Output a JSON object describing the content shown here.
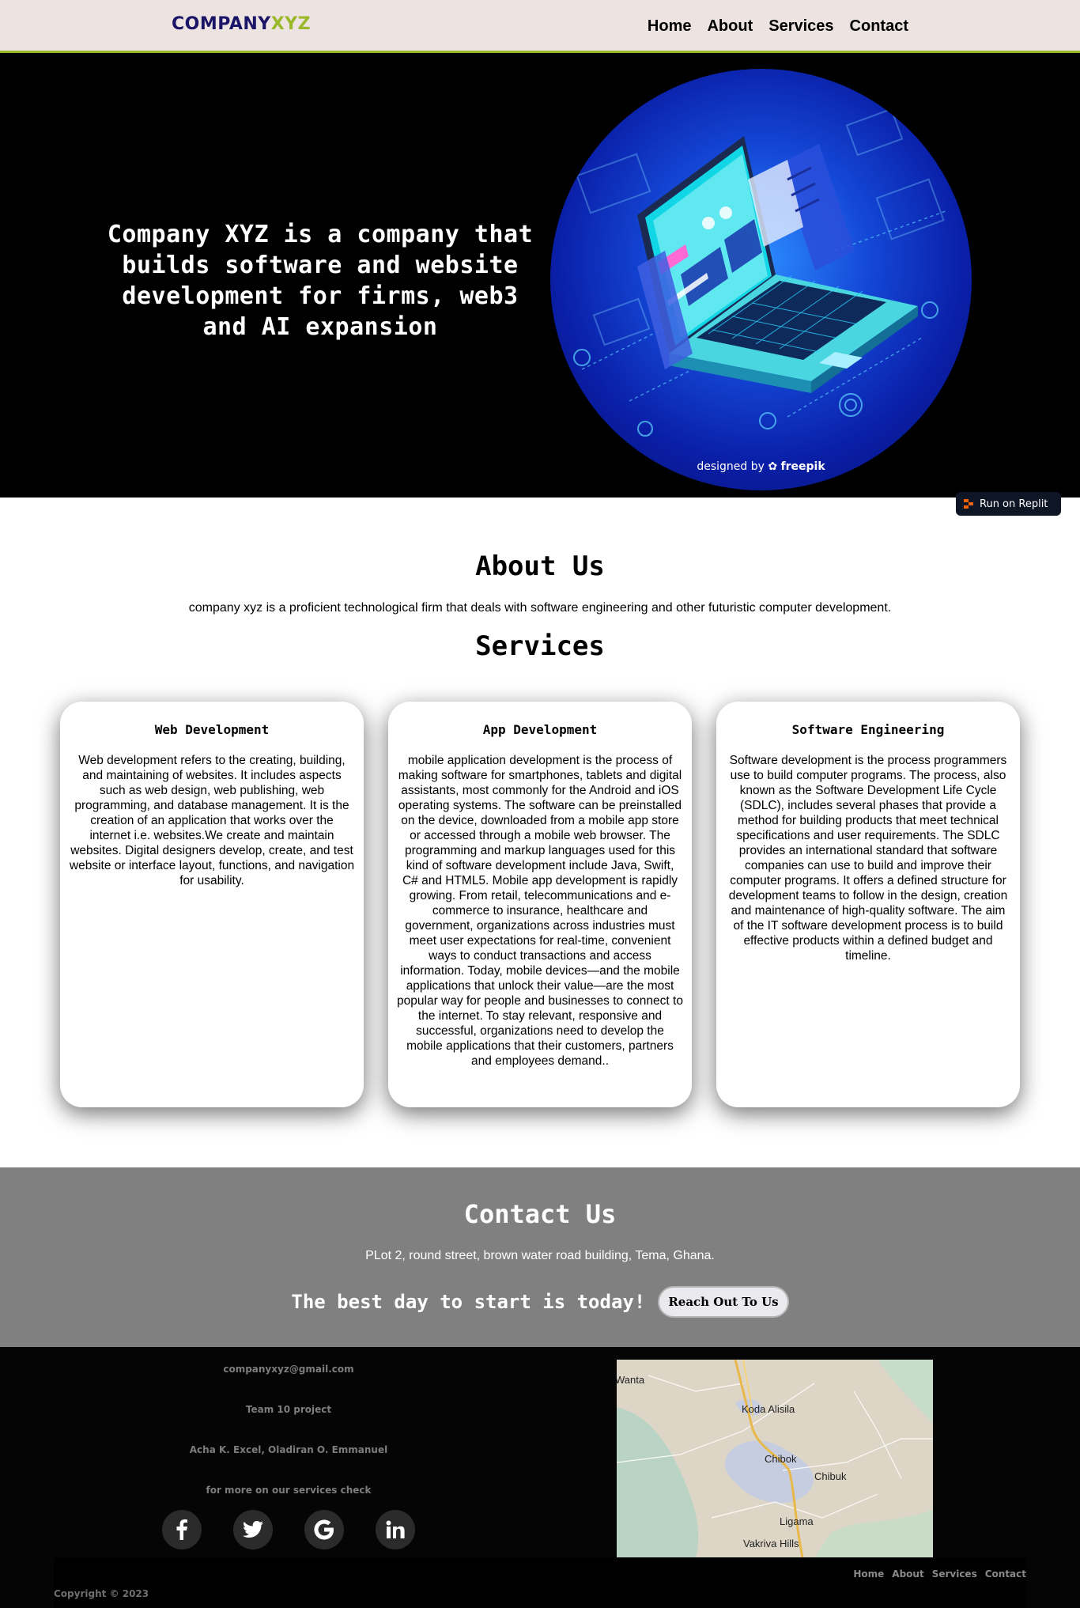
{
  "header": {
    "logo_part1": "COMPANY",
    "logo_part2": "XYZ",
    "nav": [
      "Home",
      "About",
      "Services",
      "Contact"
    ]
  },
  "hero": {
    "headline": "Company XYZ is a company that builds software and website development for firms, web3 and AI expansion",
    "image_credit_prefix": "designed by",
    "image_credit_brand": "freepik",
    "image_icon": "laptop-illustration"
  },
  "replit_badge": "Run on Replit",
  "about": {
    "title": "About Us",
    "text": "company xyz is a proficient technological firm that deals with software engineering and other futuristic computer development."
  },
  "services": {
    "title": "Services",
    "cards": [
      {
        "title": "Web Development",
        "text": "Web development refers to the creating, building, and maintaining of websites. It includes aspects such as web design, web publishing, web programming, and database management. It is the creation of an application that works over the internet i.e. websites.We create and maintain websites. Digital designers develop, create, and test website or interface layout, functions, and navigation for usability."
      },
      {
        "title": "App Development",
        "text": "mobile application development is the process of making software for smartphones, tablets and digital assistants, most commonly for the Android and iOS operating systems. The software can be preinstalled on the device, downloaded from a mobile app store or accessed through a mobile web browser. The programming and markup languages used for this kind of software development include Java, Swift, C# and HTML5. Mobile app development is rapidly growing. From retail, telecommunications and e-commerce to insurance, healthcare and government, organizations across industries must meet user expectations for real-time, convenient ways to conduct transactions and access information. Today, mobile devices—and the mobile applications that unlock their value—are the most popular way for people and businesses to connect to the internet. To stay relevant, responsive and successful, organizations need to develop the mobile applications that their customers, partners and employees demand.."
      },
      {
        "title": "Software Engineering",
        "text": "Software development is the process programmers use to build computer programs. The process, also known as the Software Development Life Cycle (SDLC), includes several phases that provide a method for building products that meet technical specifications and user requirements. The SDLC provides an international standard that software companies can use to build and improve their computer programs. It offers a defined structure for development teams to follow in the design, creation and maintenance of high-quality software. The aim of the IT software development process is to build effective products within a defined budget and timeline."
      }
    ]
  },
  "contact": {
    "title": "Contact Us",
    "address": "PLot 2, round street, brown water road building, Tema, Ghana.",
    "cta_text": "The best day to start is today!",
    "cta_button": "Reach Out To Us"
  },
  "footer": {
    "email": "companyxyz@gmail.com",
    "project": "Team 10 project",
    "authors": "Acha K. Excel, Oladiran O. Emmanuel",
    "more": "for more on our services check",
    "social_icons": [
      "facebook-icon",
      "twitter-icon",
      "google-icon",
      "linkedin-icon"
    ],
    "map_labels": [
      "Wanta",
      "Koda Alisila",
      "Chibok",
      "Chibuk",
      "Ligama",
      "Vakriva Hills"
    ],
    "links": [
      "Home",
      "About",
      "Services",
      "Contact"
    ],
    "copyright": "Copyright © 2023"
  },
  "colors": {
    "logo_dark": "#1a1566",
    "logo_accent": "#9ab82a",
    "header_bg": "#ede4e2",
    "contact_bg": "#808080",
    "footer_bg": "#050505"
  }
}
